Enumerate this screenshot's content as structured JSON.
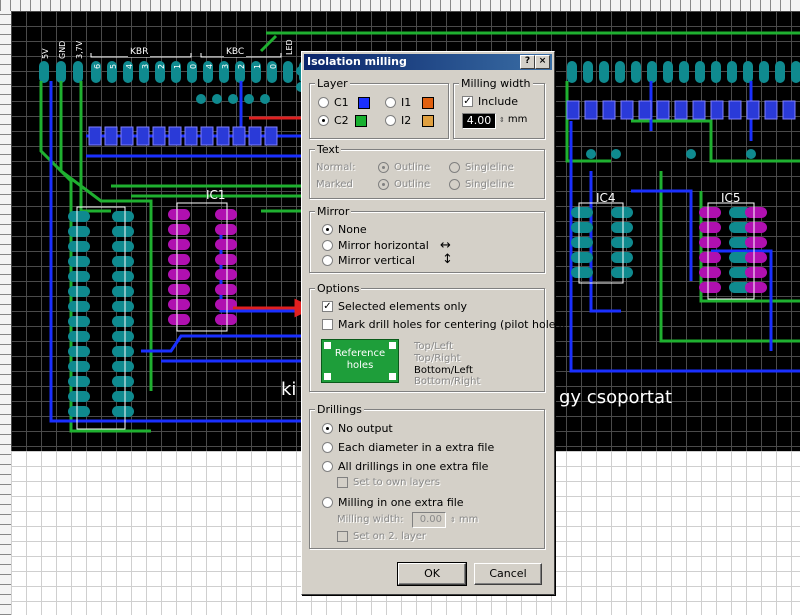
{
  "dialog": {
    "title": "Isolation milling",
    "help_btn": "?",
    "close_btn": "×",
    "layer": {
      "title": "Layer",
      "c1": "C1",
      "c2": "C2",
      "i1": "I1",
      "i2": "I2",
      "colors": {
        "c1": "#1a30ff",
        "c2": "#18b030",
        "i1": "#e06010",
        "i2": "#e0a040"
      }
    },
    "milling_width": {
      "title": "Milling width",
      "include": "Include",
      "value": "4.00",
      "unit": "mm"
    },
    "text": {
      "title": "Text",
      "normal": "Normal:",
      "marked": "Marked",
      "outline": "Outline",
      "singleline": "Singleline"
    },
    "mirror": {
      "title": "Mirror",
      "none": "None",
      "horizontal": "Mirror horizontal",
      "vertical": "Mirror vertical",
      "h_arrow": "↔",
      "v_arrow": "↕"
    },
    "options": {
      "title": "Options",
      "selected_only": "Selected elements only",
      "mark_drill": "Mark drill holes for centering (pilot holes)",
      "ref_holes": "Reference holes",
      "pos_top_left": "Top/Left",
      "pos_top_right": "Top/Right",
      "pos_bottom_left": "Bottom/Left",
      "pos_bottom_right": "Bottom/Right"
    },
    "drillings": {
      "title": "Drillings",
      "no_output": "No output",
      "each_diameter": "Each diameter in a extra file",
      "all_in_one": "All drillings in one extra file",
      "set_own_layers": "Set to own layers",
      "milling_in_one": "Milling in one extra file",
      "milling_width_label": "Milling width:",
      "milling_width_value": "0.00",
      "unit": "mm",
      "set_on_2_layer": "Set on 2. layer"
    },
    "ok": "OK",
    "cancel": "Cancel"
  },
  "pcb": {
    "label_ic1": "IC1",
    "label_ic4": "IC4",
    "label_ic5": "IC5",
    "label_kbr": "KBR",
    "label_kbc": "KBC",
    "text_left": "ki",
    "text_right": "gy csoportat",
    "pin_labels": [
      "5V",
      "GND",
      "3,7V",
      "6",
      "5",
      "4",
      "3",
      "2",
      "1",
      "0",
      "4",
      "3",
      "2",
      "1",
      "0"
    ],
    "label_led": "LED"
  }
}
